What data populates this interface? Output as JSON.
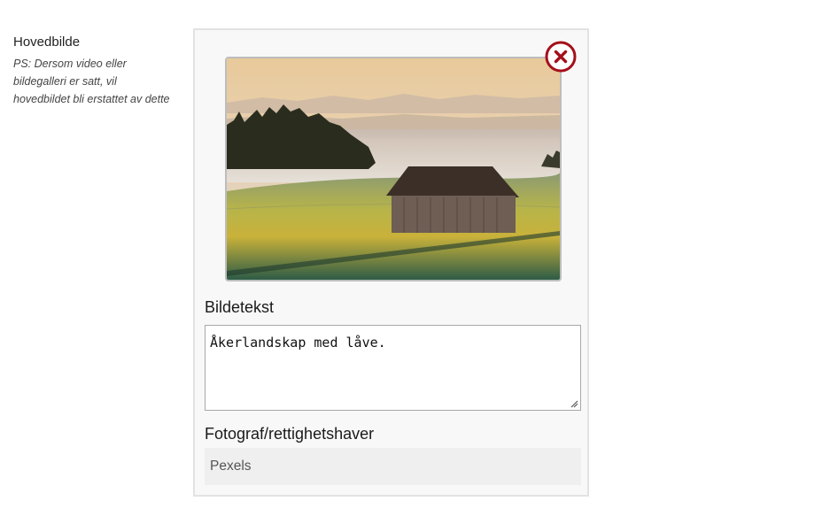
{
  "field": {
    "label": "Hovedbilde",
    "help": "PS: Dersom video eller bildegalleri er satt, vil hovedbildet bli erstattet av dette"
  },
  "image": {
    "icon": "landscape-image"
  },
  "remove_button": {
    "icon": "close-circle-icon",
    "color": "#a40f1a"
  },
  "caption": {
    "label": "Bildetekst",
    "value": "Åkerlandskap med låve."
  },
  "credit": {
    "label": "Fotograf/rettighetshaver",
    "value": "Pexels"
  }
}
